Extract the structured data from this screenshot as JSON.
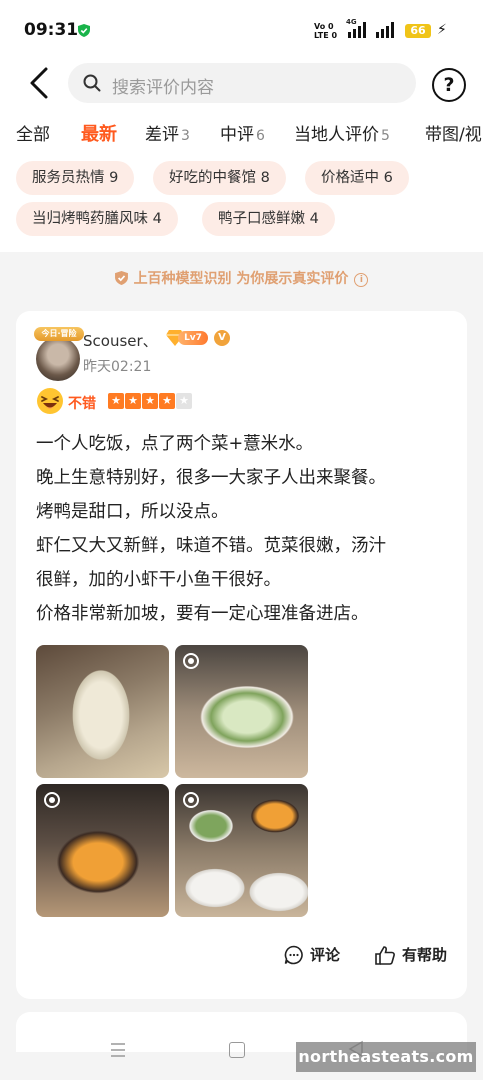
{
  "status_bar": {
    "time": "09:31",
    "net_top": "Vo 0",
    "net_bottom": "LTE 0",
    "net_gen": "4G",
    "battery": "66"
  },
  "header": {
    "search_placeholder": "搜索评价内容",
    "help_label": "?"
  },
  "tabs": [
    {
      "label": "全部",
      "count": ""
    },
    {
      "label": "最新",
      "count": "",
      "active": true
    },
    {
      "label": "差评",
      "count": "3"
    },
    {
      "label": "中评",
      "count": "6"
    },
    {
      "label": "当地人评价",
      "count": "5"
    },
    {
      "label": "带图/视",
      "count": ""
    }
  ],
  "tags": [
    "服务员热情 9",
    "好吃的中餐馆 8",
    "价格适中 6",
    "当归烤鸭药膳风味 4",
    "鸭子口感鲜嫩 4"
  ],
  "banner": {
    "text": "上百种模型识别 为你展示真实评价",
    "info_icon": "i"
  },
  "review": {
    "avatar_badge": "今日·冒险",
    "username": "Scouser、",
    "level": "Lv7",
    "verified": "V",
    "time": "昨天02:21",
    "rating_label": "不错",
    "stars": 4,
    "stars_total": 5,
    "lines": [
      "一个人吃饭，点了两个菜+薏米水。",
      "晚上生意特别好，很多一大家子人出来聚餐。",
      "烤鸭是甜口，所以没点。",
      "虾仁又大又新鲜，味道不错。苋菜很嫩，汤汁",
      "很鲜，加的小虾干小鱼干很好。",
      "价格非常新加坡，要有一定心理准备进店。"
    ],
    "actions": {
      "comment": "评论",
      "helpful": "有帮助"
    }
  },
  "watermark": "northeasteats.com",
  "colors": {
    "accent": "#ff5a1f",
    "chip_bg": "#fdece6",
    "banner_text": "#e0a072",
    "star_on": "#ff7b22"
  }
}
